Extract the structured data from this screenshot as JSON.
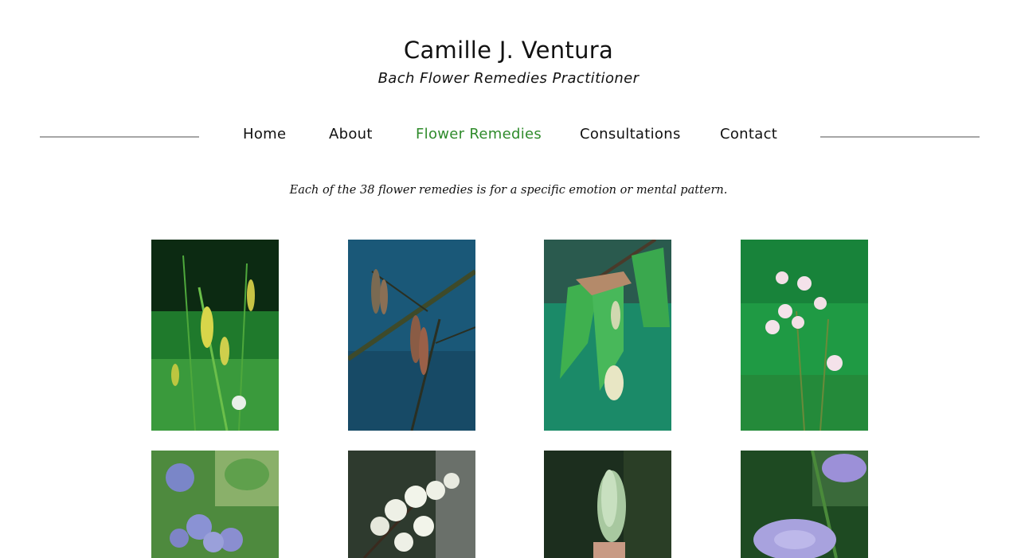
{
  "header": {
    "title": "Camille J. Ventura",
    "tagline": "Bach Flower Remedies Practitioner"
  },
  "nav": {
    "items": [
      {
        "label": "Home",
        "active": false
      },
      {
        "label": "About",
        "active": false
      },
      {
        "label": "Flower Remedies",
        "active": true
      },
      {
        "label": "Consultations",
        "active": false
      },
      {
        "label": "Contact",
        "active": false
      }
    ]
  },
  "main": {
    "intro": "Each of the 38 flower remedies is for a specific emotion or mental pattern."
  },
  "colors": {
    "accent": "#2f8b2b",
    "nav_rule": "#a6a6a6",
    "text": "#111111"
  }
}
